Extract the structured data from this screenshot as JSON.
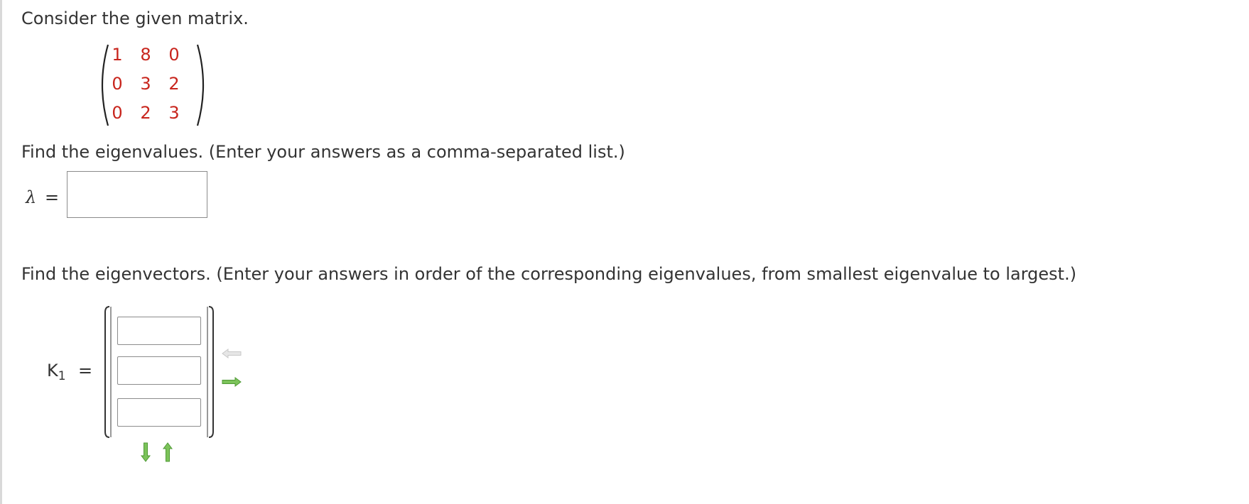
{
  "intro_text": "Consider the given matrix.",
  "matrix": {
    "rows": [
      [
        "1",
        "8",
        "0"
      ],
      [
        "0",
        "3",
        "2"
      ],
      [
        "0",
        "2",
        "3"
      ]
    ],
    "entry_color": "#c8251d"
  },
  "eigenvalues": {
    "prompt": "Find the eigenvalues. (Enter your answers as a comma-separated list.)",
    "symbol": "λ",
    "equals": "=",
    "value": ""
  },
  "eigenvectors": {
    "prompt": "Find the eigenvectors. (Enter your answers in order of the corresponding eigenvalues, from smallest eigenvalue to largest.)",
    "label": "K",
    "subscript": "1",
    "equals": "=",
    "entries": [
      "",
      "",
      ""
    ],
    "controls": {
      "remove_column": "arrow-left-icon",
      "add_column": "arrow-right-icon",
      "add_row": "arrow-down-icon",
      "remove_row": "arrow-up-icon",
      "active_color": "#5aa83f",
      "disabled_color": "#c8c8c8"
    }
  }
}
